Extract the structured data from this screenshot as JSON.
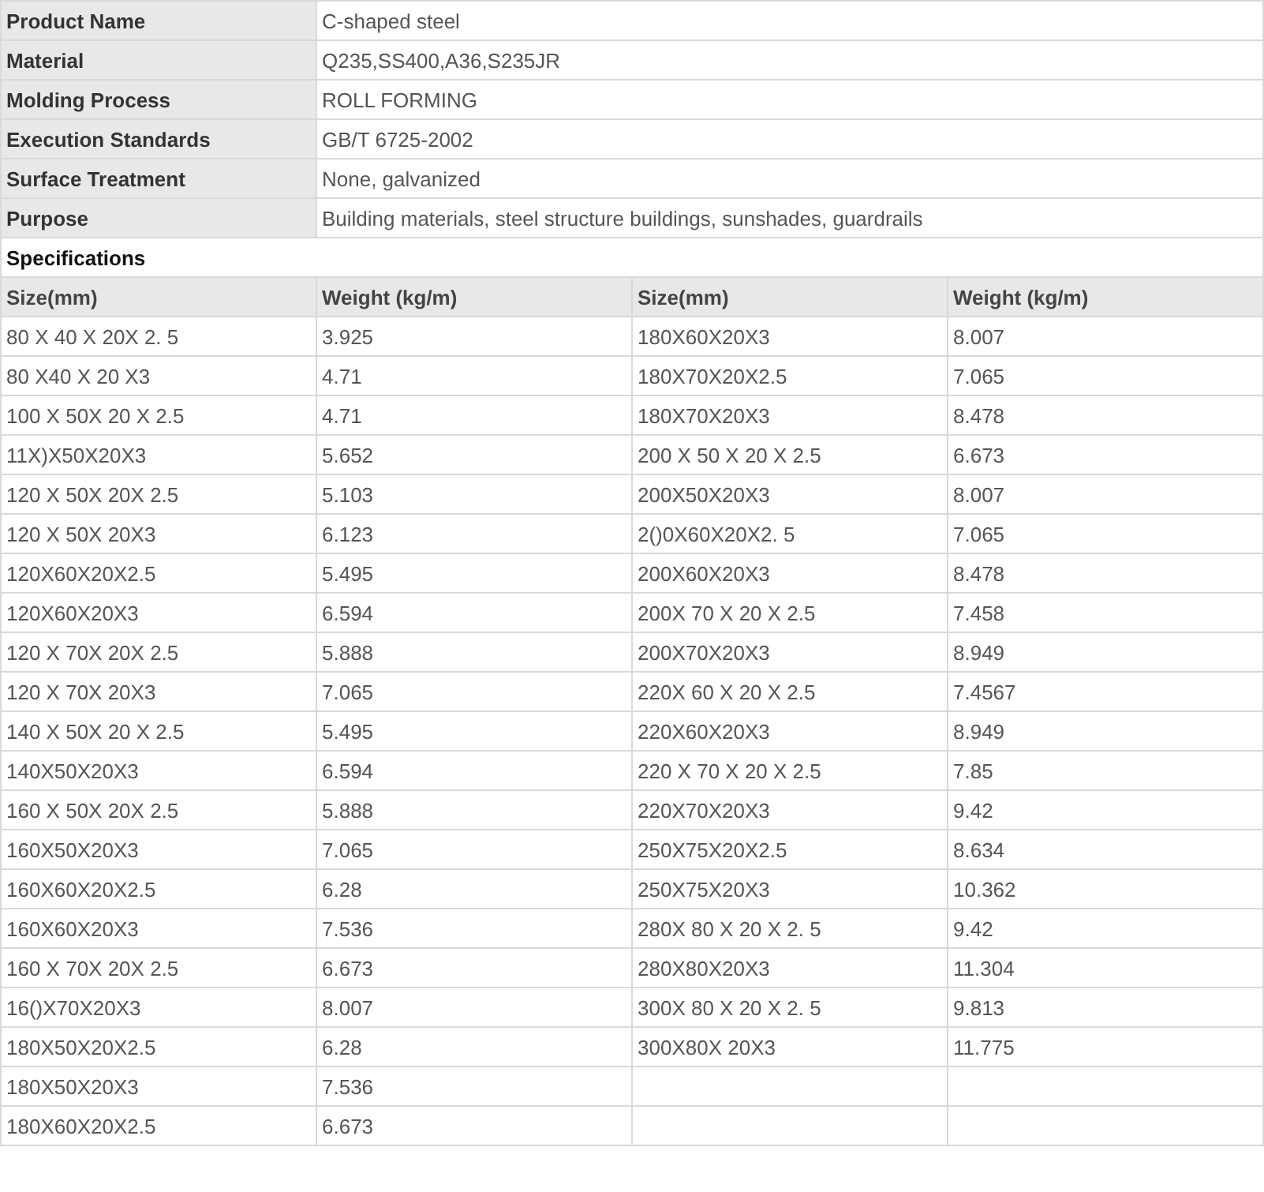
{
  "properties": [
    {
      "label": "Product Name",
      "value": "C-shaped steel"
    },
    {
      "label": "Material",
      "value": "Q235,SS400,A36,S235JR"
    },
    {
      "label": "Molding Process",
      "value": "ROLL FORMING"
    },
    {
      "label": "Execution Standards",
      "value": "GB/T 6725-2002"
    },
    {
      "label": "Surface Treatment",
      "value": "None, galvanized"
    },
    {
      "label": "Purpose",
      "value": "Building materials, steel structure buildings, sunshades, guardrails"
    }
  ],
  "specifications": {
    "title": "Specifications",
    "columns": [
      "Size(mm)",
      "Weight (kg/m)",
      "Size(mm)",
      "Weight (kg/m)"
    ],
    "rows": [
      [
        "80 X 40 X 20X 2. 5",
        "3.925",
        "180X60X20X3",
        "8.007"
      ],
      [
        "80 X40 X 20 X3",
        "4.71",
        "180X70X20X2.5",
        "7.065"
      ],
      [
        "100 X 50X 20 X 2.5",
        "4.71",
        "180X70X20X3",
        "8.478"
      ],
      [
        "11X)X50X20X3",
        "5.652",
        "200 X 50 X 20 X 2.5",
        "6.673"
      ],
      [
        "120 X 50X 20X 2.5",
        "5.103",
        "200X50X20X3",
        "8.007"
      ],
      [
        "120 X 50X 20X3",
        "6.123",
        "2()0X60X20X2. 5",
        "7.065"
      ],
      [
        "120X60X20X2.5",
        "5.495",
        "200X60X20X3",
        "8.478"
      ],
      [
        "120X60X20X3",
        "6.594",
        "200X 70 X 20 X 2.5",
        "7.458"
      ],
      [
        "120 X 70X 20X 2.5",
        "5.888",
        "200X70X20X3",
        "8.949"
      ],
      [
        "120 X 70X 20X3",
        "7.065",
        "220X 60 X 20 X 2.5",
        "7.4567"
      ],
      [
        "140 X 50X 20 X 2.5",
        "5.495",
        "220X60X20X3",
        "8.949"
      ],
      [
        "140X50X20X3",
        "6.594",
        "220 X 70 X 20 X 2.5",
        "7.85"
      ],
      [
        "160 X 50X 20X 2.5",
        "5.888",
        "220X70X20X3",
        "9.42"
      ],
      [
        "160X50X20X3",
        "7.065",
        "250X75X20X2.5",
        "8.634"
      ],
      [
        "160X60X20X2.5",
        "6.28",
        "250X75X20X3",
        "10.362"
      ],
      [
        "160X60X20X3",
        "7.536",
        "280X 80 X 20 X 2. 5",
        "9.42"
      ],
      [
        "160 X 70X 20X 2.5",
        "6.673",
        "280X80X20X3",
        "11.304"
      ],
      [
        "16()X70X20X3",
        "8.007",
        "300X 80 X 20 X 2. 5",
        "9.813"
      ],
      [
        "180X50X20X2.5",
        "6.28",
        "300X80X 20X3",
        "11.775"
      ],
      [
        "180X50X20X3",
        "7.536"
      ],
      [
        "180X60X20X2.5",
        "6.673"
      ]
    ]
  }
}
